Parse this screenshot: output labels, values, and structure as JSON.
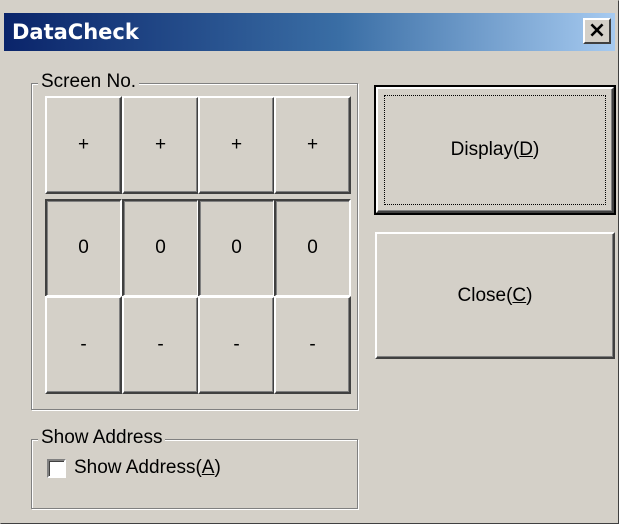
{
  "window": {
    "title": "DataCheck",
    "close_glyph": "✕"
  },
  "screen_group": {
    "legend": "Screen No.",
    "plus_row": [
      "+",
      "+",
      "+",
      "+"
    ],
    "value_row": [
      "0",
      "0",
      "0",
      "0"
    ],
    "minus_row": [
      "-",
      "-",
      "-",
      "-"
    ]
  },
  "buttons": {
    "display": {
      "label": "Display(",
      "mnemonic": "D",
      "suffix": ")"
    },
    "close": {
      "label": "Close(",
      "mnemonic": "C",
      "suffix": ")"
    }
  },
  "address_group": {
    "legend": "Show Address",
    "checkbox": {
      "label": "Show Address(",
      "mnemonic": "A",
      "suffix": ")",
      "checked": false
    }
  }
}
